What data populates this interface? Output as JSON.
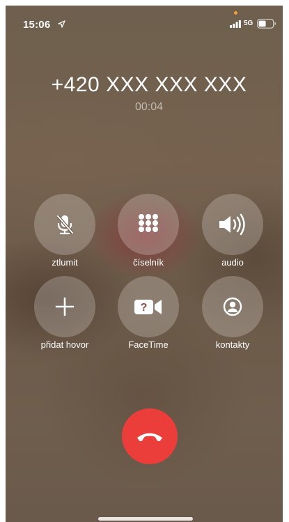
{
  "status_bar": {
    "time": "15:06",
    "network": "5G",
    "icons": [
      "location-arrow-icon",
      "signal-bars-icon",
      "battery-icon"
    ]
  },
  "call": {
    "number": "+420 XXX XXX XXX",
    "duration": "00:04"
  },
  "controls": [
    {
      "label": "ztlumit",
      "icon": "mic-off-icon"
    },
    {
      "label": "číselník",
      "icon": "keypad-icon"
    },
    {
      "label": "audio",
      "icon": "speaker-icon"
    },
    {
      "label": "přidat hovor",
      "icon": "plus-icon"
    },
    {
      "label": "FaceTime",
      "icon": "facetime-icon"
    },
    {
      "label": "kontakty",
      "icon": "contacts-icon"
    }
  ],
  "end_call": {
    "icon": "end-call-icon",
    "color": "#eb3d3a"
  }
}
